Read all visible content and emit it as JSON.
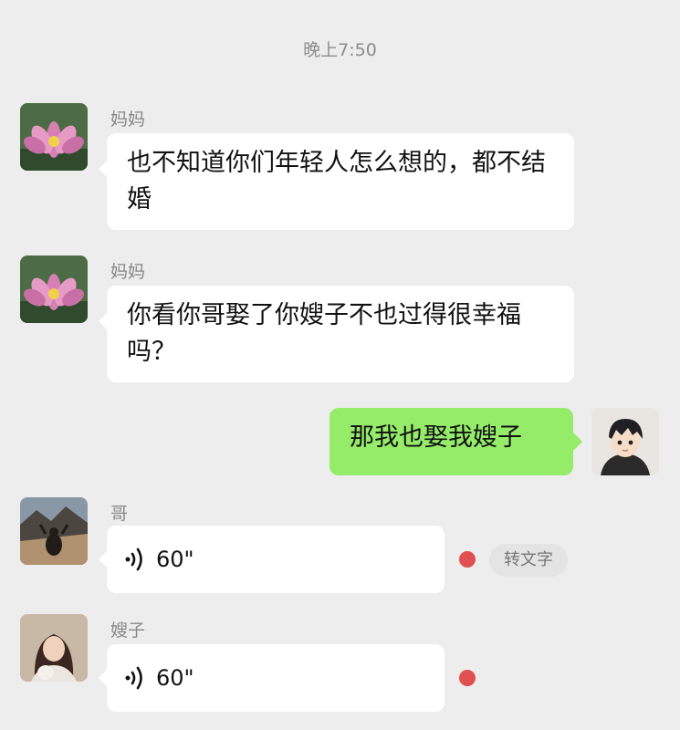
{
  "chat": {
    "timestamp": "晚上7:50",
    "messages": [
      {
        "sender": "妈妈",
        "text": "也不知道你们年轻人怎么想的，都不结婚"
      },
      {
        "sender": "妈妈",
        "text": "你看你哥娶了你嫂子不也过得很幸福吗？"
      },
      {
        "sender": "me",
        "text": "那我也娶我嫂子"
      },
      {
        "sender": "哥",
        "voice_duration": "60\"",
        "convert_label": "转文字"
      },
      {
        "sender": "嫂子",
        "voice_duration": "60\""
      }
    ]
  },
  "icons": {
    "avatar_mom": "lotus-flower",
    "avatar_me": "anime-boy",
    "avatar_brother": "mountain-landscape",
    "avatar_sister_in_law": "woman-photo",
    "voice": "voice-wave-icon"
  },
  "colors": {
    "incoming_bubble": "#ffffff",
    "outgoing_bubble": "#95ec69",
    "unread_dot": "#e05050",
    "background": "#ededed"
  }
}
